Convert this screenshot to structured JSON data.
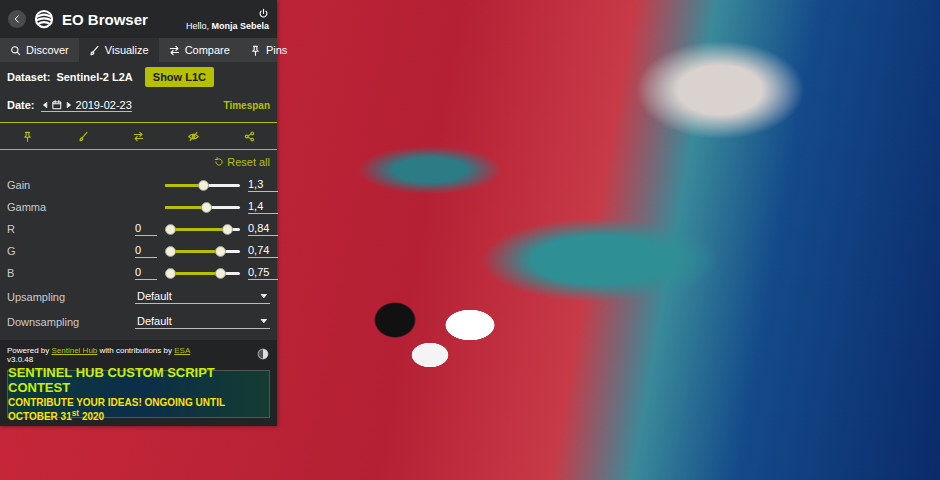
{
  "header": {
    "title": "EO Browser",
    "greeting": "Hello, ",
    "user": "Monja Sebela"
  },
  "tabs": [
    {
      "label": "Discover",
      "selected": false
    },
    {
      "label": "Visualize",
      "selected": true
    },
    {
      "label": "Compare",
      "selected": false
    },
    {
      "label": "Pins",
      "selected": false
    }
  ],
  "dataset": {
    "label": "Dataset:",
    "value": "Sentinel-2 L2A",
    "button": "Show L1C"
  },
  "date": {
    "label": "Date:",
    "value": "2019-02-23",
    "timespan": "Timespan"
  },
  "reset": "Reset all",
  "sliders": [
    {
      "kind": "single",
      "label": "Gain",
      "level": 0.52,
      "value": "1,3"
    },
    {
      "kind": "single",
      "label": "Gamma",
      "level": 0.56,
      "value": "1,4"
    },
    {
      "kind": "range",
      "label": "R",
      "min": "0",
      "level": 0.84,
      "value": "0,84"
    },
    {
      "kind": "range",
      "label": "G",
      "min": "0",
      "level": 0.74,
      "value": "0,74"
    },
    {
      "kind": "range",
      "label": "B",
      "min": "0",
      "level": 0.75,
      "value": "0,75"
    }
  ],
  "selects": [
    {
      "label": "Upsampling",
      "value": "Default"
    },
    {
      "label": "Downsampling",
      "value": "Default"
    }
  ],
  "footer": {
    "powered": "Powered by ",
    "sentinel_hub": "Sentinel Hub",
    "with": " with contributions by ",
    "esa": "ESA",
    "version": "v3.0.48"
  },
  "banner": {
    "title": "SENTINEL HUB CUSTOM SCRIPT CONTEST",
    "subtitle": "CONTRIBUTE YOUR IDEAS! ONGOING UNTIL OCTOBER 31",
    "sup": "st",
    "tail": " 2020"
  }
}
